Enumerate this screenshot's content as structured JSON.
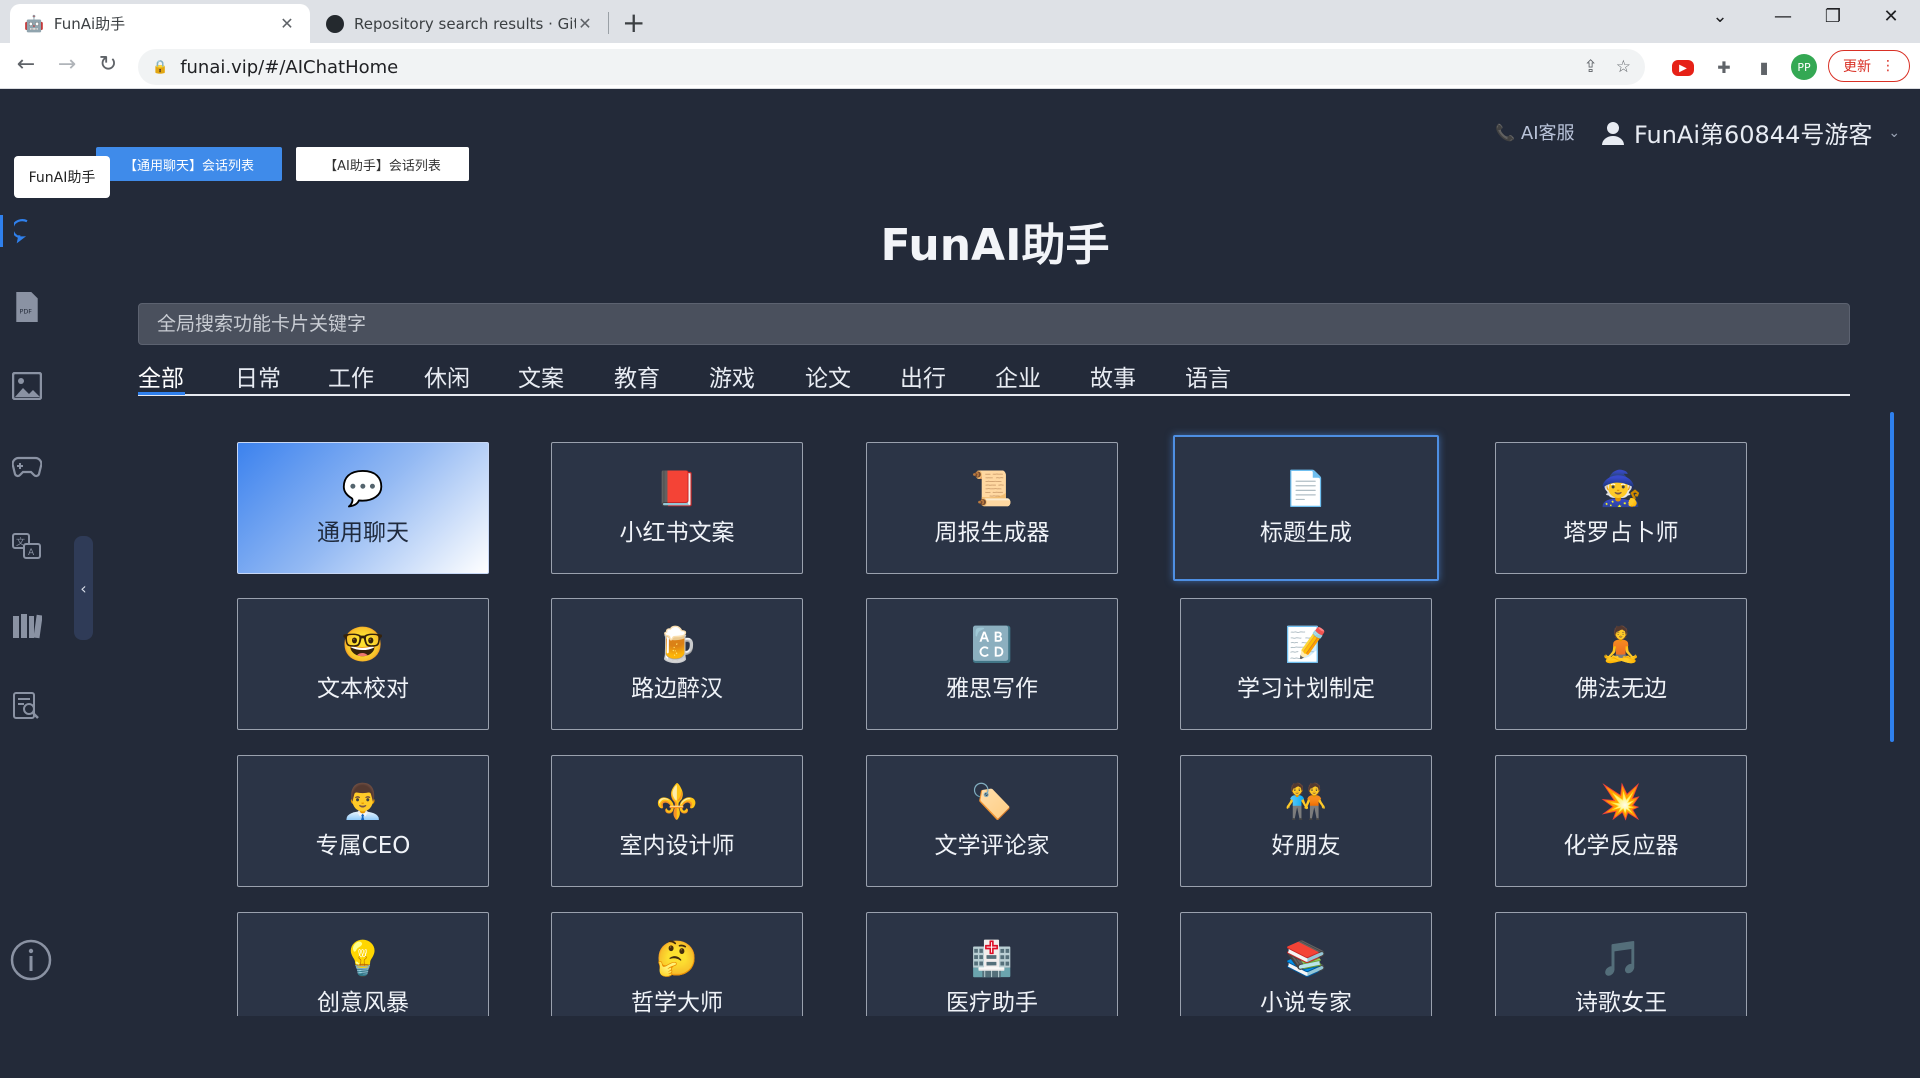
{
  "browser": {
    "tabs": [
      {
        "title": "FunAi助手",
        "close": "✕",
        "icon": "robot-icon"
      },
      {
        "title": "Repository search results · GitHub",
        "close": "✕",
        "icon": "github-icon"
      }
    ],
    "new_tab": "+",
    "url": "funai.vip/#/AIChatHome",
    "profile_initials": "PP",
    "update_label": "更新"
  },
  "app": {
    "tooltip": "FunAI助手",
    "session_buttons": {
      "primary": "【通用聊天】会话列表",
      "secondary": "【AI助手】会话列表"
    },
    "service_label": "AI客服",
    "user_label": "FunAi第60844号游客",
    "title": "FunAI助手",
    "search_placeholder": "全局搜索功能卡片关键字",
    "categories": [
      "全部",
      "日常",
      "工作",
      "休闲",
      "文案",
      "教育",
      "游戏",
      "论文",
      "出行",
      "企业",
      "故事",
      "语言"
    ],
    "sidebar_icons": [
      "chat-icon",
      "pdf-icon",
      "image-icon",
      "gamepad-icon",
      "translate-icon",
      "library-icon",
      "search-doc-icon",
      "info-icon"
    ],
    "cards": [
      {
        "label": "通用聊天",
        "emoji": "💬",
        "icon": "speech-bubble-icon"
      },
      {
        "label": "小红书文案",
        "emoji": "📕",
        "icon": "red-book-icon"
      },
      {
        "label": "周报生成器",
        "emoji": "📜",
        "icon": "scroll-icon"
      },
      {
        "label": "标题生成",
        "emoji": "📄",
        "icon": "page-icon"
      },
      {
        "label": "塔罗占卜师",
        "emoji": "🧙",
        "icon": "wizard-icon"
      },
      {
        "label": "文本校对",
        "emoji": "🤓",
        "icon": "nerd-face-icon"
      },
      {
        "label": "路边醉汉",
        "emoji": "🍺",
        "icon": "beer-icon"
      },
      {
        "label": "雅思写作",
        "emoji": "🔠",
        "icon": "abcd-icon"
      },
      {
        "label": "学习计划制定",
        "emoji": "📝",
        "icon": "memo-icon"
      },
      {
        "label": "佛法无边",
        "emoji": "🧘",
        "icon": "meditation-icon"
      },
      {
        "label": "专属CEO",
        "emoji": "👨‍💼",
        "icon": "office-worker-icon"
      },
      {
        "label": "室内设计师",
        "emoji": "⚜️",
        "icon": "fleur-de-lis-icon"
      },
      {
        "label": "文学评论家",
        "emoji": "🏷️",
        "icon": "label-tag-icon"
      },
      {
        "label": "好朋友",
        "emoji": "🧑‍🤝‍🧑",
        "icon": "friends-icon"
      },
      {
        "label": "化学反应器",
        "emoji": "💥",
        "icon": "explosion-icon"
      },
      {
        "label": "创意风暴",
        "emoji": "💡",
        "icon": "light-bulb-icon"
      },
      {
        "label": "哲学大师",
        "emoji": "🤔",
        "icon": "thinking-face-icon"
      },
      {
        "label": "医疗助手",
        "emoji": "🏥",
        "icon": "hospital-icon"
      },
      {
        "label": "小说专家",
        "emoji": "📚",
        "icon": "books-icon"
      },
      {
        "label": "诗歌女王",
        "emoji": "🎵",
        "icon": "music-note-icon"
      }
    ]
  }
}
